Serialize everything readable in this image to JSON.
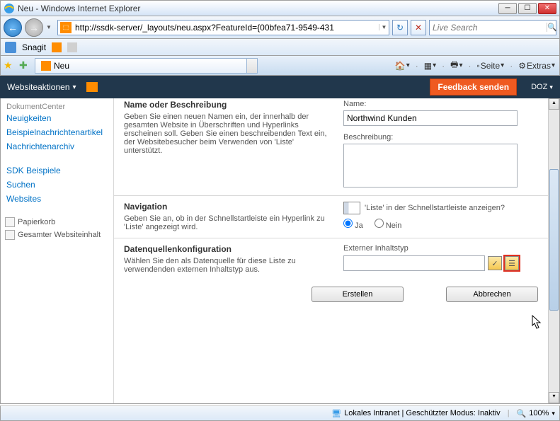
{
  "window": {
    "title": "Neu - Windows Internet Explorer"
  },
  "url": "http://ssdk-server/_layouts/neu.aspx?FeatureId={00bfea71-9549-431",
  "search_placeholder": "Live Search",
  "snagit": "Snagit",
  "tab": {
    "title": "Neu"
  },
  "cmdbar": {
    "page": "Seite",
    "extras": "Extras"
  },
  "ribbon": {
    "siteactions": "Websiteaktionen",
    "feedback": "Feedback senden",
    "user": "DOZ"
  },
  "nav": {
    "cut": "DokumentCenter",
    "items": [
      "Neuigkeiten",
      "Beispielnachrichtenartikel",
      "Nachrichtenarchiv"
    ],
    "group2": [
      "SDK Beispiele",
      "Suchen",
      "Websites"
    ],
    "recycle": "Papierkorb",
    "allcontent": "Gesamter Websiteinhalt"
  },
  "sections": {
    "name": {
      "header": "Name oder Beschreibung",
      "desc": "Geben Sie einen neuen Namen ein, der innerhalb der gesamten Website in Überschriften und Hyperlinks erscheinen soll. Geben Sie einen beschreibenden Text ein, der Websitebesucher beim Verwenden von 'Liste' unterstützt.",
      "name_label": "Name:",
      "name_value": "Northwind Kunden",
      "desc_label": "Beschreibung:"
    },
    "navi": {
      "header": "Navigation",
      "desc": "Geben Sie an, ob in der Schnellstartleiste ein Hyperlink zu 'Liste' angezeigt wird.",
      "question": "'Liste' in der Schnellstartleiste anzeigen?",
      "yes": "Ja",
      "no": "Nein"
    },
    "ds": {
      "header": "Datenquellenkonfiguration",
      "desc": "Wählen Sie den als Datenquelle für diese Liste zu verwendenden externen Inhaltstyp aus.",
      "label": "Externer Inhaltstyp"
    }
  },
  "buttons": {
    "create": "Erstellen",
    "cancel": "Abbrechen"
  },
  "status": {
    "zone": "Lokales Intranet | Geschützter Modus: Inaktiv",
    "zoom": "100%"
  }
}
